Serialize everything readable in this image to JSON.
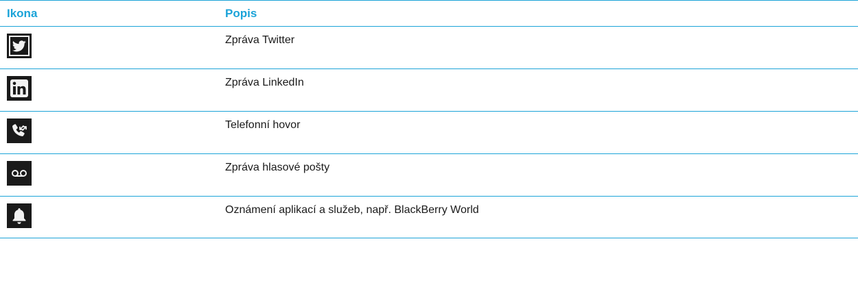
{
  "table": {
    "header": {
      "icon_col": "Ikona",
      "desc_col": "Popis"
    },
    "rows": [
      {
        "icon": "twitter-icon",
        "description": "Zpráva Twitter"
      },
      {
        "icon": "linkedin-icon",
        "description": "Zpráva LinkedIn"
      },
      {
        "icon": "phone-call-icon",
        "description": "Telefonní hovor"
      },
      {
        "icon": "voicemail-icon",
        "description": "Zpráva hlasové pošty"
      },
      {
        "icon": "bell-icon",
        "description": "Oznámení aplikací a služeb, např. BlackBerry World"
      }
    ]
  },
  "colors": {
    "accent": "#1ba3d8",
    "icon_background": "#1a1a1a",
    "text": "#1a1a1a"
  }
}
